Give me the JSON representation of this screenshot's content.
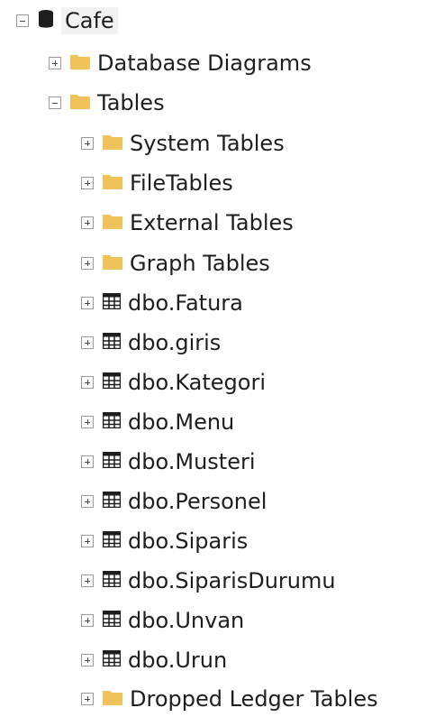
{
  "tree": {
    "root": {
      "label": "Cafe",
      "expanded": true,
      "icon": "database-icon"
    },
    "database_diagrams": {
      "label": "Database Diagrams",
      "expanded": false,
      "icon": "folder-icon"
    },
    "tables": {
      "label": "Tables",
      "expanded": true,
      "icon": "folder-icon"
    },
    "table_children": [
      {
        "label": "System Tables",
        "icon": "folder-icon",
        "expanded": false
      },
      {
        "label": "FileTables",
        "icon": "folder-icon",
        "expanded": false
      },
      {
        "label": "External Tables",
        "icon": "folder-icon",
        "expanded": false
      },
      {
        "label": "Graph Tables",
        "icon": "folder-icon",
        "expanded": false
      },
      {
        "label": "dbo.Fatura",
        "icon": "table-icon",
        "expanded": false
      },
      {
        "label": "dbo.giris",
        "icon": "table-icon",
        "expanded": false
      },
      {
        "label": "dbo.Kategori",
        "icon": "table-icon",
        "expanded": false
      },
      {
        "label": "dbo.Menu",
        "icon": "table-icon",
        "expanded": false
      },
      {
        "label": "dbo.Musteri",
        "icon": "table-icon",
        "expanded": false
      },
      {
        "label": "dbo.Personel",
        "icon": "table-icon",
        "expanded": false
      },
      {
        "label": "dbo.Siparis",
        "icon": "table-icon",
        "expanded": false
      },
      {
        "label": "dbo.SiparisDurumu",
        "icon": "table-icon",
        "expanded": false
      },
      {
        "label": "dbo.Unvan",
        "icon": "table-icon",
        "expanded": false
      },
      {
        "label": "dbo.Urun",
        "icon": "table-icon",
        "expanded": false
      },
      {
        "label": "Dropped Ledger Tables",
        "icon": "folder-icon",
        "expanded": false
      }
    ]
  },
  "colors": {
    "folder": "#f0c25a",
    "database": "#1e1e1e",
    "text": "#1e1e1e",
    "toggle_border": "#9a9a9a",
    "selection": "#f2f2f2"
  }
}
